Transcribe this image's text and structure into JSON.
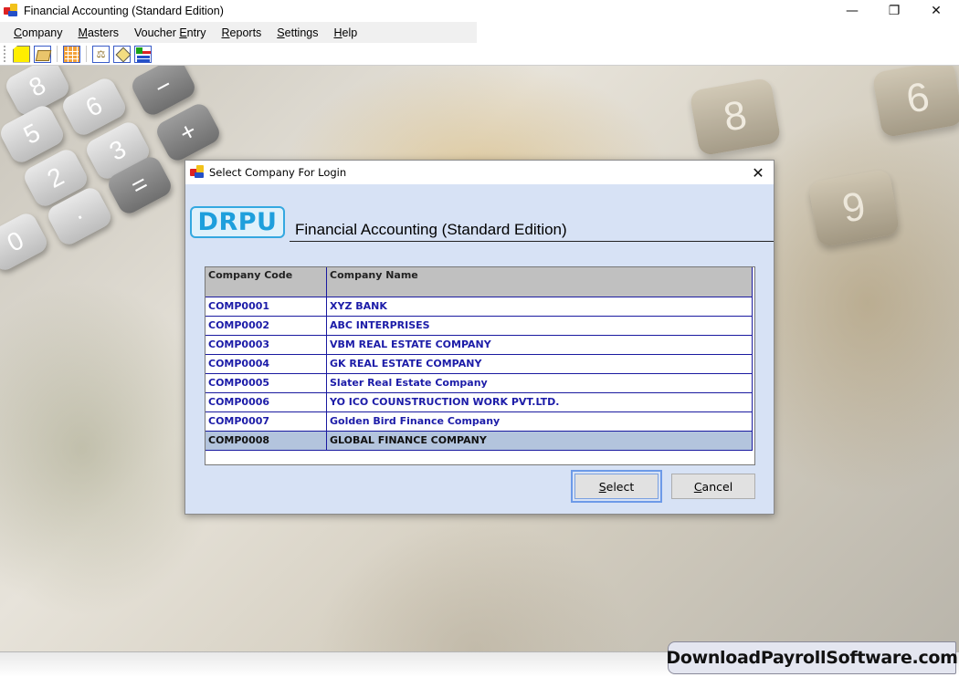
{
  "window": {
    "title": "Financial Accounting (Standard Edition)",
    "controls": {
      "minimize": "—",
      "restore": "❐",
      "close": "✕"
    }
  },
  "menu": {
    "items": [
      {
        "label": "Company",
        "mnemonic": "C",
        "rest": "ompany"
      },
      {
        "label": "Masters",
        "mnemonic": "M",
        "rest": "asters"
      },
      {
        "label": "Voucher Entry",
        "pre": "Voucher ",
        "mnemonic": "E",
        "rest": "ntry"
      },
      {
        "label": "Reports",
        "mnemonic": "R",
        "rest": "eports"
      },
      {
        "label": "Settings",
        "mnemonic": "S",
        "rest": "ettings"
      },
      {
        "label": "Help",
        "mnemonic": "H",
        "rest": "elp"
      }
    ]
  },
  "toolbar": {
    "buttons": [
      {
        "icon": "new-document-icon"
      },
      {
        "icon": "open-folder-icon"
      },
      {
        "icon": "grid-table-icon"
      },
      {
        "icon": "balance-scale-icon",
        "glyph": "⚖"
      },
      {
        "icon": "voucher-diamond-icon"
      },
      {
        "icon": "add-row-icon"
      }
    ]
  },
  "background": {
    "calculator_keys": [
      "8",
      "6",
      "5",
      "3",
      "2",
      "+",
      "=",
      "·",
      "0",
      "−"
    ],
    "right_keys": [
      "8",
      "9",
      "6"
    ]
  },
  "dialog": {
    "title": "Select Company For Login",
    "close": "✕",
    "logo": "DRPU",
    "product_title": "Financial Accounting (Standard Edition)",
    "table": {
      "columns": [
        "Company Code",
        "Company Name"
      ],
      "rows": [
        {
          "code": "COMP0001",
          "name": "XYZ BANK"
        },
        {
          "code": "COMP0002",
          "name": "ABC INTERPRISES"
        },
        {
          "code": "COMP0003",
          "name": "VBM REAL ESTATE COMPANY"
        },
        {
          "code": "COMP0004",
          "name": "GK REAL ESTATE COMPANY"
        },
        {
          "code": "COMP0005",
          "name": "Slater Real Estate Company"
        },
        {
          "code": "COMP0006",
          "name": "YO ICO COUNSTRUCTION WORK PVT.LTD."
        },
        {
          "code": "COMP0007",
          "name": "Golden Bird Finance Company"
        },
        {
          "code": "COMP0008",
          "name": "GLOBAL FINANCE COMPANY"
        }
      ],
      "selected_code": "COMP0008"
    },
    "buttons": {
      "select": {
        "label": "Select",
        "mnemonic": "S",
        "rest": "elect"
      },
      "cancel": {
        "label": "Cancel",
        "mnemonic": "C",
        "rest": "ancel"
      }
    }
  },
  "colors": {
    "dialog_bg": "#d7e2f5",
    "grid_text": "#1c1ca8",
    "grid_header_bg": "#c0c0c0",
    "selected_row_bg": "#b3c4dd",
    "logo_blue": "#1e9fdc"
  },
  "watermark": "DownloadPayrollSoftware.com"
}
